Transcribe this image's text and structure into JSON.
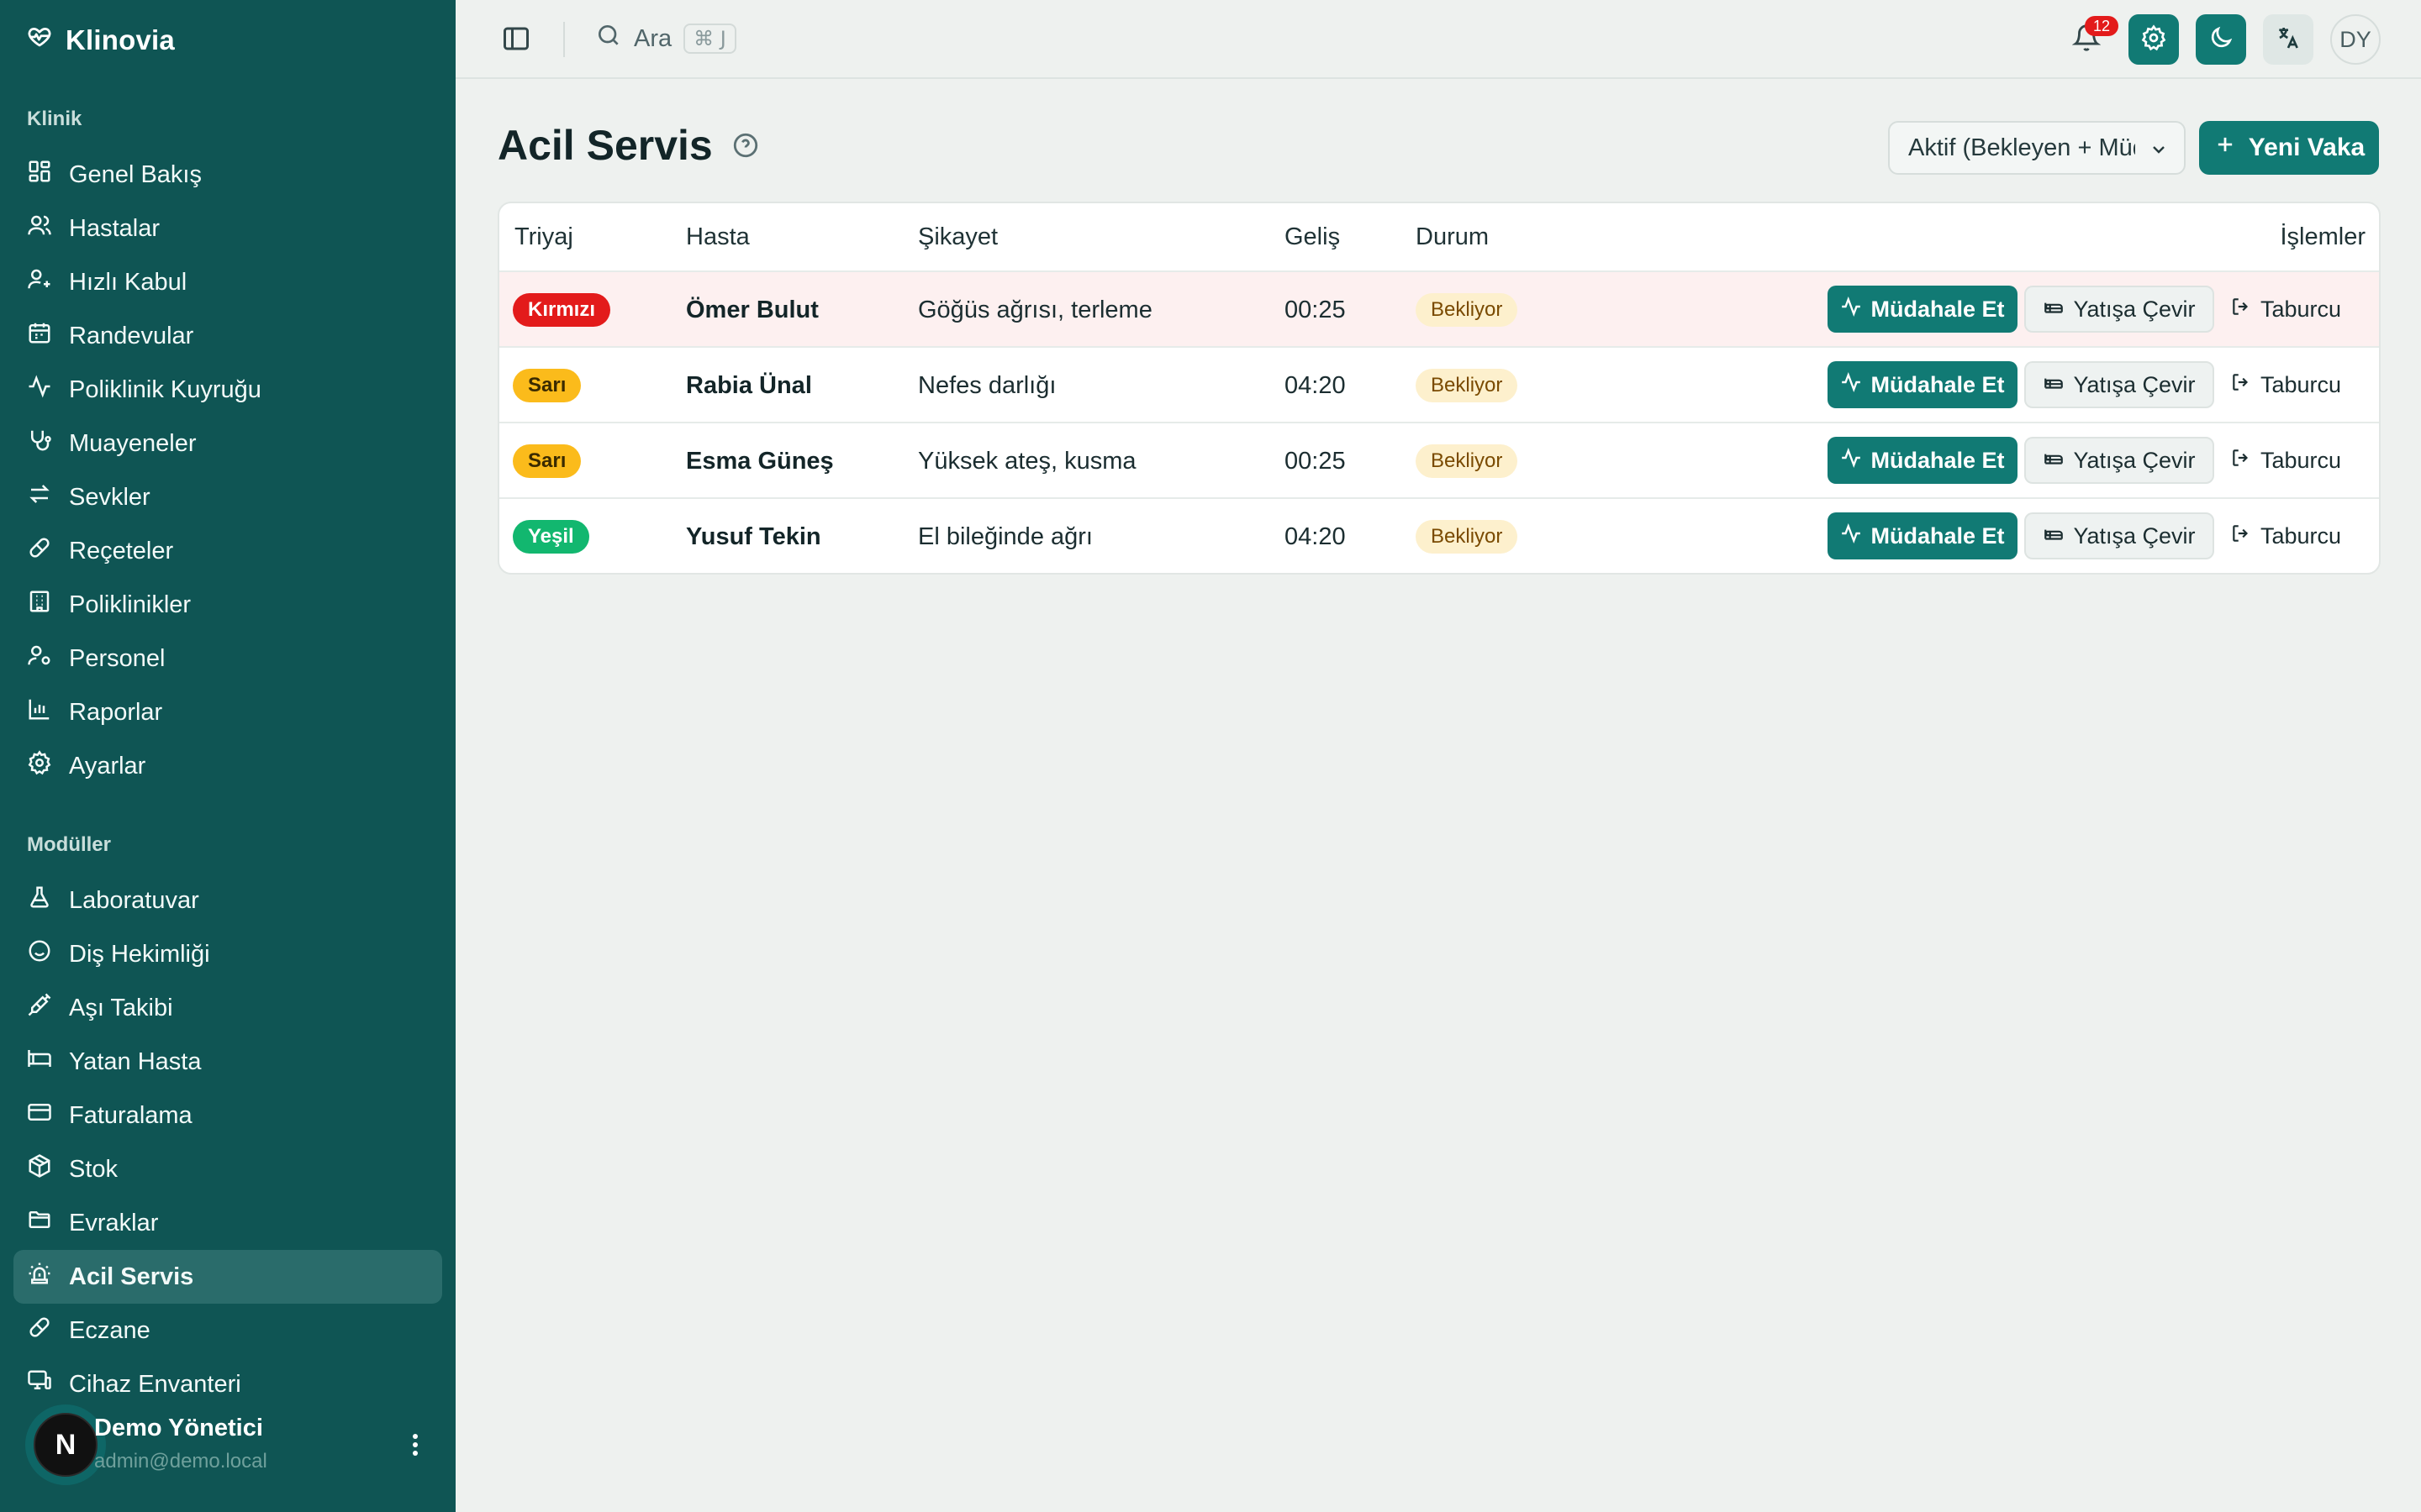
{
  "app": {
    "brand": "Klinovia"
  },
  "sidebar": {
    "section_clinic": "Klinik",
    "section_modules": "Modüller",
    "clinic_items": [
      {
        "label": "Genel Bakış",
        "icon": "dashboard-icon"
      },
      {
        "label": "Hastalar",
        "icon": "users-icon"
      },
      {
        "label": "Hızlı Kabul",
        "icon": "user-plus-icon"
      },
      {
        "label": "Randevular",
        "icon": "calendar-icon"
      },
      {
        "label": "Poliklinik Kuyruğu",
        "icon": "activity-icon"
      },
      {
        "label": "Muayeneler",
        "icon": "stethoscope-icon"
      },
      {
        "label": "Sevkler",
        "icon": "arrows-exchange-icon"
      },
      {
        "label": "Reçeteler",
        "icon": "pill-icon"
      },
      {
        "label": "Poliklinikler",
        "icon": "building-icon"
      },
      {
        "label": "Personel",
        "icon": "user-cog-icon"
      },
      {
        "label": "Raporlar",
        "icon": "bar-chart-icon"
      },
      {
        "label": "Ayarlar",
        "icon": "gear-icon"
      }
    ],
    "module_items": [
      {
        "label": "Laboratuvar",
        "icon": "flask-icon"
      },
      {
        "label": "Diş Hekimliği",
        "icon": "smile-icon"
      },
      {
        "label": "Aşı Takibi",
        "icon": "syringe-icon"
      },
      {
        "label": "Yatan Hasta",
        "icon": "bed-icon"
      },
      {
        "label": "Faturalama",
        "icon": "credit-card-icon"
      },
      {
        "label": "Stok",
        "icon": "package-icon"
      },
      {
        "label": "Evraklar",
        "icon": "folder-icon"
      },
      {
        "label": "Acil Servis",
        "icon": "siren-icon",
        "active": true
      },
      {
        "label": "Eczane",
        "icon": "pill-icon"
      },
      {
        "label": "Cihaz Envanteri",
        "icon": "monitor-icon"
      }
    ],
    "user": {
      "avatar_letter": "N",
      "name": "Demo Yönetici",
      "email": "admin@demo.local"
    }
  },
  "topbar": {
    "search_label": "Ara",
    "search_shortcut": "⌘ J",
    "notification_count": "12",
    "user_initials": "DY"
  },
  "page": {
    "title": "Acil Servis",
    "filter_value": "Aktif (Bekleyen + Müdahalede)",
    "new_button": "Yeni Vaka"
  },
  "table": {
    "headers": {
      "triage": "Triyaj",
      "patient": "Hasta",
      "complaint": "Şikayet",
      "arrival": "Geliş",
      "status": "Durum",
      "actions": "İşlemler"
    },
    "action_labels": {
      "intervene": "Müdahale Et",
      "admit": "Yatışa Çevir",
      "discharge": "Taburcu"
    },
    "rows": [
      {
        "triage": "Kırmızı",
        "triage_level": "kirmizi",
        "patient": "Ömer Bulut",
        "complaint": "Göğüs ağrısı, terleme",
        "arrival": "00:25",
        "status": "Bekliyor"
      },
      {
        "triage": "Sarı",
        "triage_level": "sari",
        "patient": "Rabia Ünal",
        "complaint": "Nefes darlığı",
        "arrival": "04:20",
        "status": "Bekliyor"
      },
      {
        "triage": "Sarı",
        "triage_level": "sari",
        "patient": "Esma Güneş",
        "complaint": "Yüksek ateş, kusma",
        "arrival": "00:25",
        "status": "Bekliyor"
      },
      {
        "triage": "Yeşil",
        "triage_level": "yesil",
        "patient": "Yusuf Tekin",
        "complaint": "El bileğinde ağrı",
        "arrival": "04:20",
        "status": "Bekliyor"
      }
    ]
  },
  "colors": {
    "sidebar_bg": "#0f5554",
    "accent": "#117a74",
    "triage_red": "#e31b1b",
    "triage_yellow": "#fbbb1b",
    "triage_green": "#12b76f",
    "status_waiting_bg": "#fdf0cd"
  }
}
